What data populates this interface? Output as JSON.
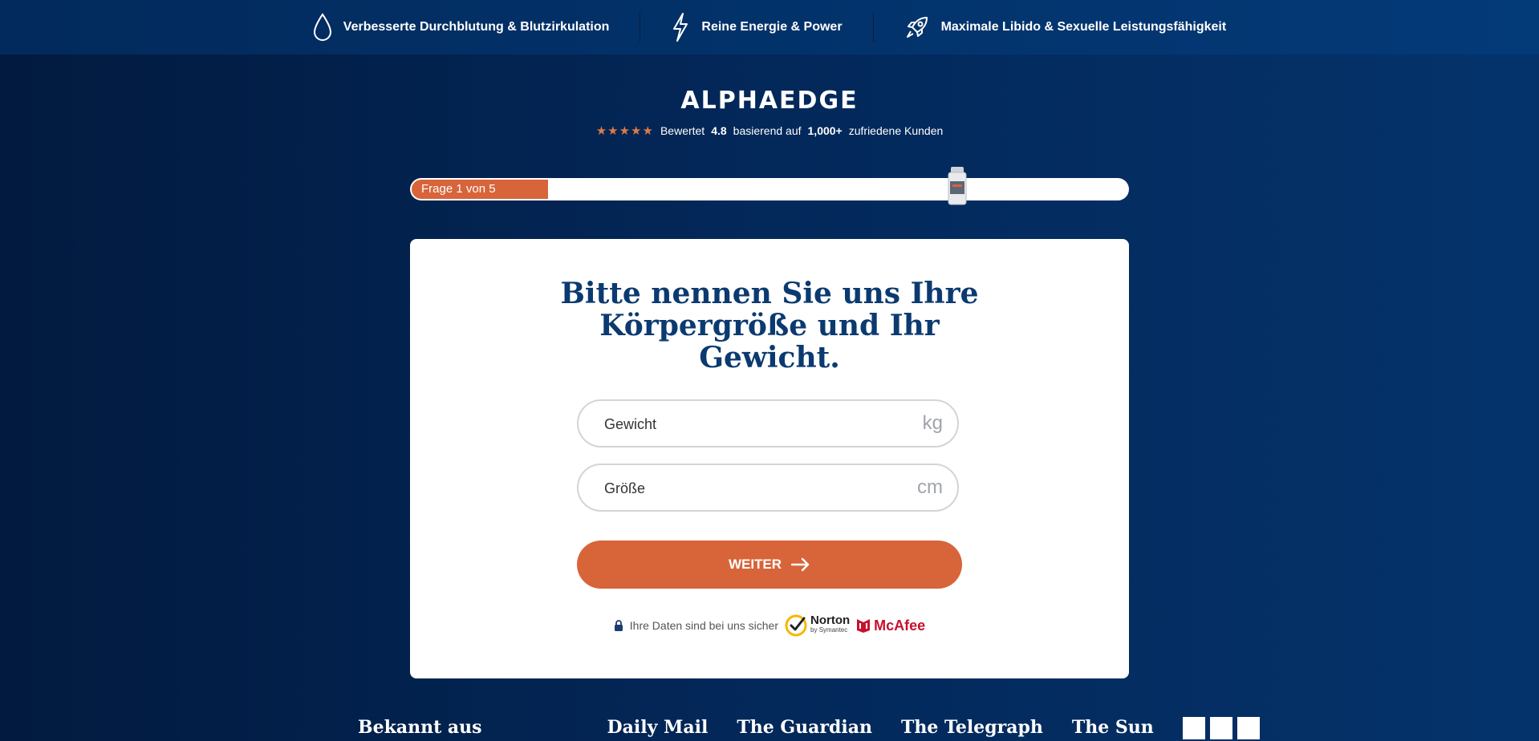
{
  "benefits": [
    {
      "icon": "drop-icon",
      "label": "Verbesserte Durchblutung & Blutzirkulation"
    },
    {
      "icon": "lightning-icon",
      "label": "Reine Energie & Power"
    },
    {
      "icon": "rocket-icon",
      "label": "Maximale Libido & Sexuelle Leistungsfähigkeit"
    }
  ],
  "brand": {
    "logo_text": "ALPHAEDGE"
  },
  "rating": {
    "stars": "★★★★★",
    "prefix": "Bewertet",
    "score": "4.8",
    "middle": "basierend auf",
    "count": "1,000+",
    "suffix": "zufriedene Kunden"
  },
  "progress": {
    "label": "Frage 1 von 5",
    "current": 1,
    "total": 5
  },
  "question": {
    "lines": [
      "Bitte nennen Sie uns Ihre",
      "Körpergröße und Ihr",
      "Gewicht."
    ]
  },
  "fields": {
    "weight": {
      "placeholder": "Gewicht",
      "value": "",
      "unit": "kg"
    },
    "height": {
      "placeholder": "Größe",
      "value": "",
      "unit": "cm"
    }
  },
  "cta": {
    "label": "WEITER"
  },
  "security": {
    "text": "Ihre Daten sind bei uns sicher",
    "norton": "Norton",
    "norton_sub": "by Symantec",
    "mcafee": "McAfee"
  },
  "press": {
    "label": "Bekannt aus",
    "outlets": [
      "Daily Mail",
      "The Guardian",
      "The Telegraph",
      "The Sun"
    ]
  },
  "colors": {
    "accent": "#d8643a",
    "navy": "#0b3a70",
    "background": "#03285a"
  }
}
